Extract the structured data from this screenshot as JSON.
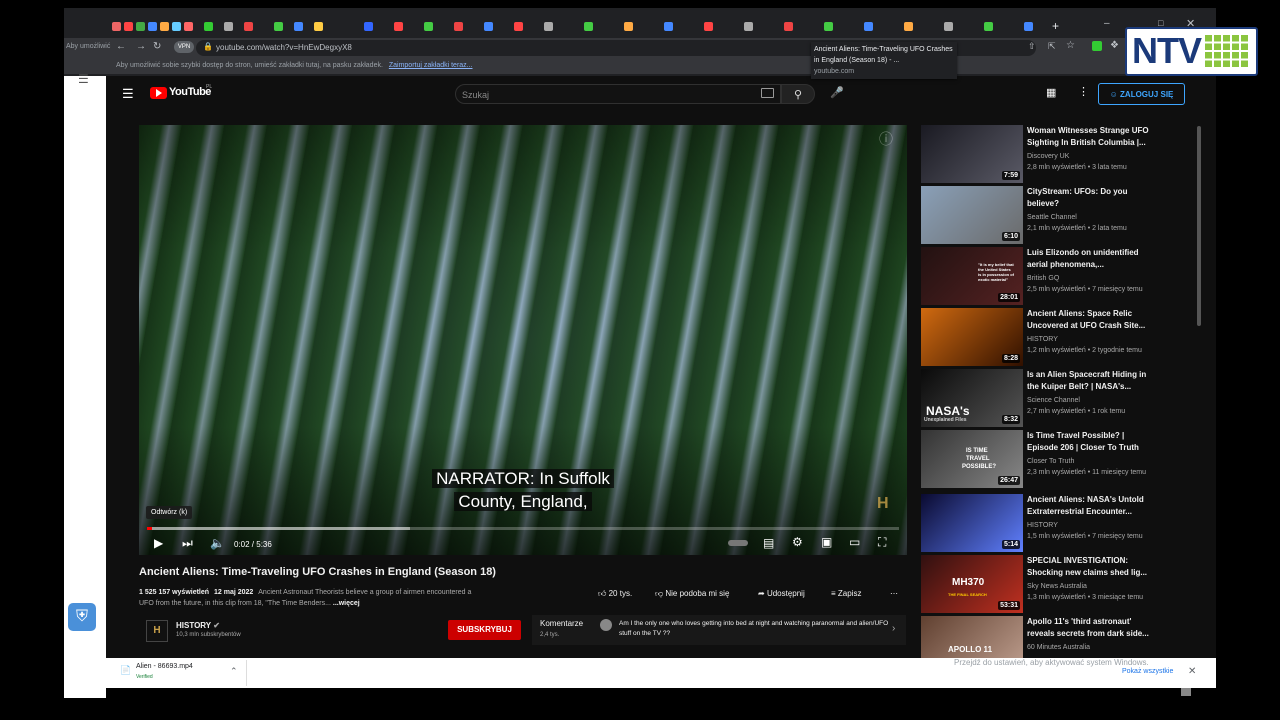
{
  "browser": {
    "url": "youtube.com/watch?v=HnEwDegxyX8",
    "bookmarks_hint": "Aby umożliwić sobie szybki dostęp do stron, umieść zakładki tutaj, na pasku zakładek.",
    "bookmarks_link": "Zaimportuj zakładki teraz...",
    "left_stub_text": "Aby umożliwić",
    "vpn_label": "VPN",
    "tab_tooltip": {
      "title": "Ancient Aliens: Time-Traveling UFO Crashes in England (Season 18) - ...",
      "domain": "youtube.com"
    }
  },
  "youtube": {
    "logo": "YouTube",
    "region": "PL",
    "search_placeholder": "Szukaj",
    "login_label": "ZALOGUJ SIĘ"
  },
  "player": {
    "caption_line1": "NARRATOR: In Suffolk",
    "caption_line2": "County, England,",
    "tooltip": "Odtwórz (k)",
    "time": "0:02 / 5:36",
    "progress_played": 0.006,
    "progress_buffered": 0.35,
    "watermark_glyph": "H"
  },
  "video": {
    "title": "Ancient Aliens: Time-Traveling UFO Crashes in England (Season 18)",
    "views": "1 525 157 wyświetleń",
    "date": "12 maj 2022",
    "description": "Ancient Astronaut Theorists believe a group of airmen encountered a UFO from the future, in this clip from 18, \"The Time Benders...",
    "more": "...więcej",
    "likes": "20 tys.",
    "dislike": "Nie podoba mi się",
    "share": "Udostępnij",
    "save": "Zapisz",
    "channel": "HISTORY",
    "subscribers": "10,3 mln subskrybentów",
    "subscribe_label": "SUBSKRYBUJ",
    "comments_label": "Komentarze",
    "comments_count": "2,4 tys.",
    "top_comment": "Am I the only one who loves getting into bed at night and watching paranormal and alien/UFO stuff on the TV ??"
  },
  "recommendations": [
    {
      "title_l1": "Woman Witnesses Strange UFO",
      "title_l2": "Sighting In British Columbia |...",
      "channel": "Discovery UK",
      "meta": "2,8 mln wyświetleń • 3 lata temu",
      "duration": "7:59",
      "c1": "#1a1a22",
      "c2": "#5a5a66"
    },
    {
      "title_l1": "CityStream: UFOs: Do you",
      "title_l2": "believe?",
      "channel": "Seattle Channel",
      "meta": "2,1 mln wyświetleń • 2 lata temu",
      "duration": "6:10",
      "c1": "#8aa0b8",
      "c2": "#6a6a6a"
    },
    {
      "title_l1": "Luis Elizondo on unidentified",
      "title_l2": "aerial phenomena,...",
      "channel": "British GQ",
      "meta": "2,5 mln wyświetleń • 7 miesięcy temu",
      "duration": "28:01",
      "c1": "#221111",
      "c2": "#552222"
    },
    {
      "title_l1": "Ancient Aliens: Space Relic",
      "title_l2": "Uncovered at UFO Crash Site...",
      "channel": "HISTORY",
      "meta": "1,2 mln wyświetleń • 2 tygodnie temu",
      "duration": "8:28",
      "c1": "#d06a10",
      "c2": "#301000"
    },
    {
      "title_l1": "Is an Alien Spacecraft Hiding in",
      "title_l2": "the Kuiper Belt? | NASA's...",
      "channel": "Science Channel",
      "meta": "2,7 mln wyświetleń • 1 rok temu",
      "duration": "8:32",
      "c1": "#0a0a0a",
      "c2": "#555555"
    },
    {
      "title_l1": "Is Time Travel Possible? |",
      "title_l2": "Episode 206 | Closer To Truth",
      "channel": "Closer To Truth",
      "meta": "2,3 mln wyświetleń • 11 miesięcy temu",
      "duration": "26:47",
      "c1": "#333333",
      "c2": "#888888"
    },
    {
      "title_l1": "Ancient Aliens: NASA's Untold",
      "title_l2": "Extraterrestrial Encounter...",
      "channel": "HISTORY",
      "meta": "1,5 mln wyświetleń • 7 miesięcy temu",
      "duration": "5:14",
      "c1": "#0a0a30",
      "c2": "#6080ff"
    },
    {
      "title_l1": "SPECIAL INVESTIGATION:",
      "title_l2": "Shocking new claims shed lig...",
      "channel": "Sky News Australia",
      "meta": "1,3 mln wyświetleń • 3 miesiące temu",
      "duration": "53:31",
      "c1": "#301010",
      "c2": "#c03020"
    },
    {
      "title_l1": "Apollo 11's 'third astronaut'",
      "title_l2": "reveals secrets from dark side...",
      "channel": "60 Minutes Australia",
      "meta": "",
      "duration": "",
      "c1": "#604030",
      "c2": "#c0a090"
    }
  ],
  "thumb_labels": {
    "nasa": "NASA's",
    "nasa_sub": "Unexplained Files",
    "mh370": "MH370",
    "final_search": "THE FINAL SEARCH",
    "apollo": "APOLLO 11",
    "time_travel_l1": "IS TIME",
    "time_travel_l2": "TRAVEL",
    "time_travel_l3": "POSSIBLE?",
    "quote_l1": "\"It is my belief that",
    "quote_l2": "the United States",
    "quote_l3": "is in possession of",
    "quote_l4": "exotic material\""
  },
  "download": {
    "filename": "Alien - 86693.mp4",
    "status": "Verified",
    "show_all": "Pokaż wszystkie"
  },
  "windows_watermark": "Przejdź do ustawień, aby aktywować system Windows.",
  "overlay_logo": "NTV",
  "colors": {
    "accent": "#3ea6ff",
    "subscribe": "#cc0000",
    "progress": "#ff0000",
    "ntv_blue": "#1b3a7a",
    "ntv_green": "#8bc53f"
  }
}
